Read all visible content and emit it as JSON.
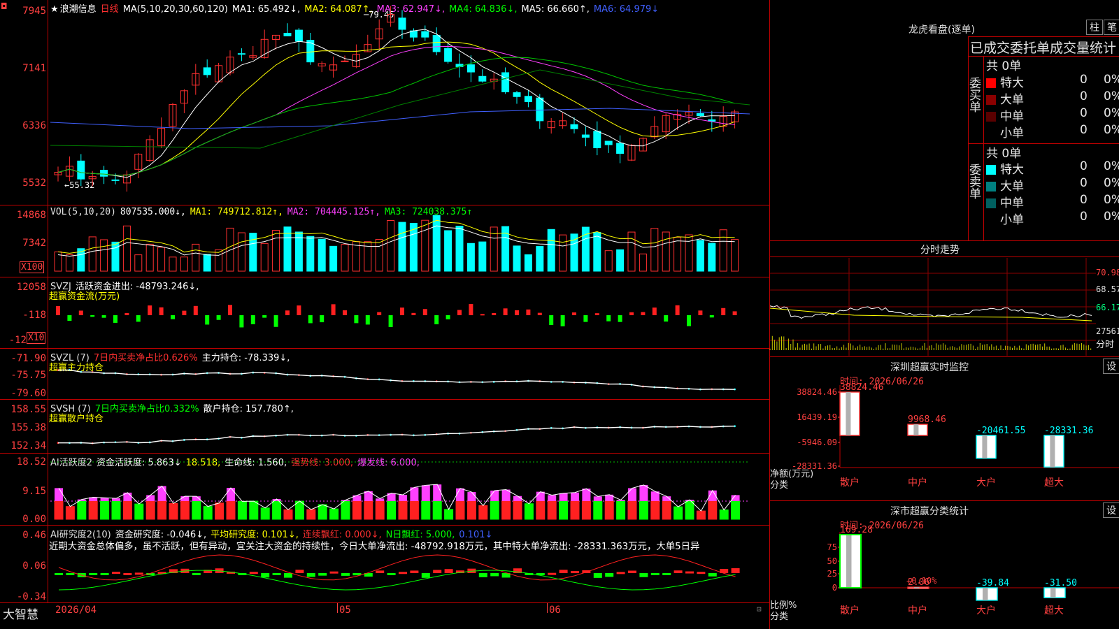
{
  "kline": {
    "title": "浪潮信息",
    "period": "日线",
    "ma_label": "MA(5,10,20,30,60,120)",
    "ma1": "MA1: 65.492↓,",
    "ma2": "MA2: 64.087↑,",
    "ma3": "MA3: 62.947↓,",
    "ma4": "MA4: 64.836↓,",
    "ma5": "MA5: 66.660↑,",
    "ma6": "MA6: 64.979↓",
    "high_mark": "79.45",
    "low_mark": "←55.32",
    "yticks": [
      "7945",
      "7141",
      "6336",
      "5532"
    ]
  },
  "vol": {
    "label": "VOL(5,10,20)",
    "value": "807535.000↓,",
    "ma1": "MA1: 749712.812↑,",
    "ma2": "MA2: 704445.125↑,",
    "ma3": "MA3: 724038.375↑",
    "yticks": [
      "14868",
      "7342"
    ],
    "unit": "X100"
  },
  "svzj": {
    "label": "SVZJ",
    "name": "活跃资金进出: -48793.246↓,",
    "sub": "超赢资金流(万元)",
    "yticks": [
      "12058",
      "-118",
      "-12"
    ],
    "unit": "X10"
  },
  "svzl": {
    "label": "SVZL (7)",
    "pct": "7日内买卖净占比0.626%",
    "hold": "主力持仓: -78.339↓,",
    "sub": "超赢主力持仓",
    "yticks": [
      "-71.90",
      "-75.75",
      "-79.60"
    ]
  },
  "svsh": {
    "label": "SVSH (7)",
    "pct": "7日内买卖净占比0.332%",
    "hold": "散户持仓: 157.780↑,",
    "sub": "超赢散户持仓",
    "yticks": [
      "158.55",
      "155.38",
      "152.34"
    ]
  },
  "ai1": {
    "label": "AI活跃度2",
    "a": "资金活跃度: 5.863↓",
    "b": "18.518,",
    "c": "生命线: 1.560,",
    "d": "强势线: 3.000,",
    "e": "爆发线: 6.000,",
    "yticks": [
      "18.52",
      "9.15",
      "0.00"
    ]
  },
  "ai2": {
    "label": "AI研究度2(10)",
    "a": "资金研究度: -0.046↓,",
    "b": "平均研究度: 0.101↓,",
    "c": "连续飘红: 0.000↓,",
    "d": "N日飘红: 5.000,",
    "e": "0.101↓",
    "text": "近期大资金总体偏多，虽不活跃，但有异动，宜关注大资金的持续性，今日大单净流出: -48792.918万元，其中特大单净流出: -28331.363万元，大单5日异",
    "yticks": [
      "0.46",
      "0.06",
      "-0.34"
    ]
  },
  "dates": [
    "2026/04",
    "05",
    "06"
  ],
  "brand": "大智慧",
  "lhb": {
    "title": "龙虎看盘(逐单)",
    "btn1": "柱",
    "btn2": "笔",
    "subtitle": "已成交委托单成交量统计",
    "buy_label": "委买单",
    "sell_label": "委卖单",
    "buy_total": "共 0单",
    "sell_total": "共 0单",
    "buy_rows": [
      {
        "name": "特大",
        "v": "0",
        "p": "0%",
        "color": "#ff0000"
      },
      {
        "name": "大单",
        "v": "0",
        "p": "0%",
        "color": "#8b0000"
      },
      {
        "name": "中单",
        "v": "0",
        "p": "0%",
        "color": "#5a0000"
      },
      {
        "name": "小单",
        "v": "0",
        "p": "0%",
        "color": "#000000"
      }
    ],
    "sell_rows": [
      {
        "name": "特大",
        "v": "0",
        "p": "0%",
        "color": "#00ffff"
      },
      {
        "name": "大单",
        "v": "0",
        "p": "0%",
        "color": "#008080"
      },
      {
        "name": "中单",
        "v": "0",
        "p": "0%",
        "color": "#006060"
      },
      {
        "name": "小单",
        "v": "0",
        "p": "0%",
        "color": "#000000"
      }
    ]
  },
  "fs": {
    "title": "分时走势",
    "yticks": [
      "70.98",
      "68.57",
      "66.17",
      "27561"
    ],
    "unit": "分时"
  },
  "sz": {
    "title": "深圳超赢实时监控",
    "btn": "设",
    "time": "时间: 2026/06/26",
    "yticks": [
      "38824.46",
      "16439.19",
      "-5946.09",
      "-28331.36"
    ],
    "ylabel": "净额(万元)",
    "xlabel": "分类",
    "cats": [
      "散户",
      "中户",
      "大户",
      "超大"
    ],
    "values": [
      38824.46,
      9968.46,
      -20461.55,
      -28331.36
    ],
    "labels": [
      "38824.46",
      "9968.46",
      "-20461.55",
      "-28331.36"
    ]
  },
  "ss": {
    "title": "深市超赢分类统计",
    "btn": "设",
    "time": "时间: 2026/06/26",
    "yticks": [
      "75",
      "50",
      "25",
      "0"
    ],
    "ylabel": "比例%",
    "xlabel": "分类",
    "cats": [
      "散户",
      "中户",
      "大户",
      "超大"
    ],
    "values": [
      169.28,
      2.06,
      -39.84,
      -31.5
    ],
    "labels": [
      "169.28",
      "2.06",
      "-39.84",
      "-31.50"
    ],
    "note": "+0.10%"
  }
}
